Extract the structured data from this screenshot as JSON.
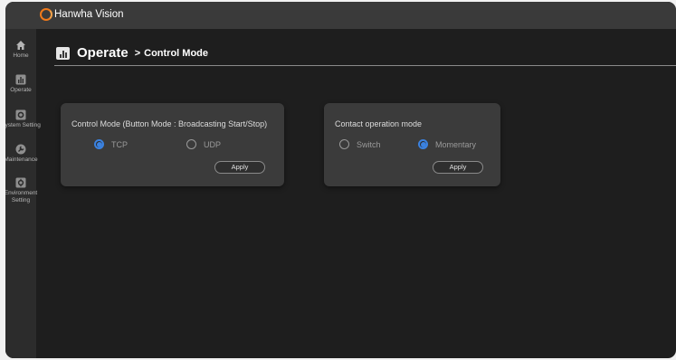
{
  "app": {
    "brand": "Hanwha Vision"
  },
  "sidebar": {
    "items": [
      {
        "label": "Home",
        "icon": "home-icon"
      },
      {
        "label": "Operate",
        "icon": "operate-icon"
      },
      {
        "label": "System Setting",
        "icon": "system-setting-icon"
      },
      {
        "label": "Maintenance",
        "icon": "maintenance-icon"
      },
      {
        "label": "Environment",
        "label2": "Setting",
        "icon": "environment-setting-icon"
      }
    ]
  },
  "header": {
    "title": "Operate",
    "separator": ">",
    "subtitle": "Control Mode"
  },
  "control_mode": {
    "title": "Control Mode (Button Mode : Broadcasting Start/Stop)",
    "options": [
      {
        "label": "TCP",
        "selected": true
      },
      {
        "label": "UDP",
        "selected": false
      }
    ],
    "apply_label": "Apply"
  },
  "contact_mode": {
    "title": "Contact operation mode",
    "options": [
      {
        "label": "Switch",
        "selected": false
      },
      {
        "label": "Momentary",
        "selected": true
      }
    ],
    "apply_label": "Apply"
  },
  "colors": {
    "accent": "#3b82e0",
    "brand_orange": "#f07a1a",
    "background": "#1e1e1e",
    "card": "#3b3b3b"
  }
}
